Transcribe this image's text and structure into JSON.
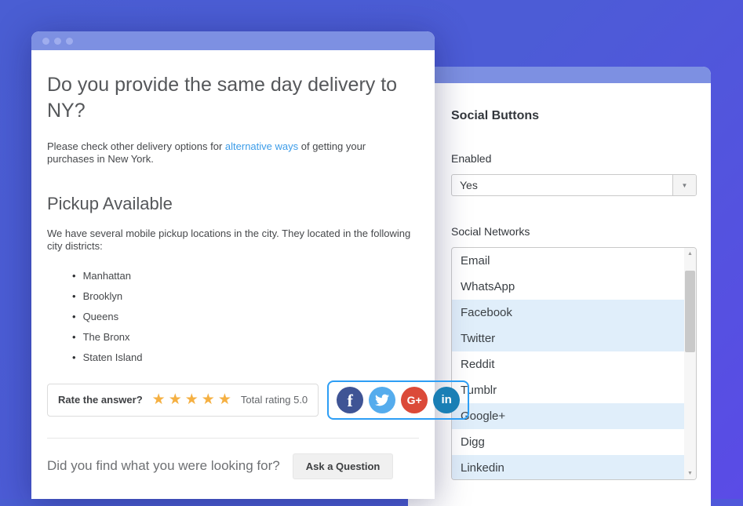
{
  "colors": {
    "background_gradient_start": "#4a5ed3",
    "background_gradient_end": "#5a4be6",
    "titlebar": "#7d90e2",
    "link": "#3c9ce8",
    "share_highlight_border": "#2d9ef5",
    "star": "#f5b042",
    "list_selected_bg": "#e0eefa",
    "facebook": "#3f5495",
    "twitter": "#55aced",
    "google_plus": "#db4a39",
    "linkedin": "#1a7fb5"
  },
  "icons": {
    "star": "★",
    "dropdown_arrow": "▼",
    "scroll_up": "▲",
    "scroll_down": "▼",
    "bullet": "•",
    "facebook_glyph": "f",
    "google_plus_glyph": "G+",
    "linkedin_glyph": "in"
  },
  "faq_card": {
    "title": "Do you provide the same day delivery to NY?",
    "intro": {
      "before_link": "Please check other delivery options for ",
      "link": "alternative ways",
      "after_link": " of getting your purchases in New York."
    },
    "pickup_section": {
      "heading": "Pickup Available",
      "body": "We have several mobile pickup locations in the city. They located in the following city districts:",
      "districts": [
        "Manhattan",
        "Brooklyn",
        "Queens",
        "The Bronx",
        "Staten Island"
      ]
    },
    "rating": {
      "label": "Rate the answer?",
      "stars_count": 5,
      "total_label": "Total rating 5.0"
    },
    "share_buttons": [
      "Facebook",
      "Twitter",
      "Google+",
      "Linkedin"
    ],
    "footer": {
      "question": "Did you find what you were looking for?",
      "button_label": "Ask a Question"
    }
  },
  "settings_panel": {
    "title": "Social Buttons",
    "enabled_field": {
      "label": "Enabled",
      "value": "Yes"
    },
    "social_networks": {
      "label": "Social Networks",
      "items": [
        {
          "label": "Email",
          "selected": false
        },
        {
          "label": "WhatsApp",
          "selected": false
        },
        {
          "label": "Facebook",
          "selected": true
        },
        {
          "label": "Twitter",
          "selected": true
        },
        {
          "label": "Reddit",
          "selected": false
        },
        {
          "label": "Tumblr",
          "selected": false
        },
        {
          "label": "Google+",
          "selected": true
        },
        {
          "label": "Digg",
          "selected": false
        },
        {
          "label": "Linkedin",
          "selected": true
        }
      ]
    }
  }
}
